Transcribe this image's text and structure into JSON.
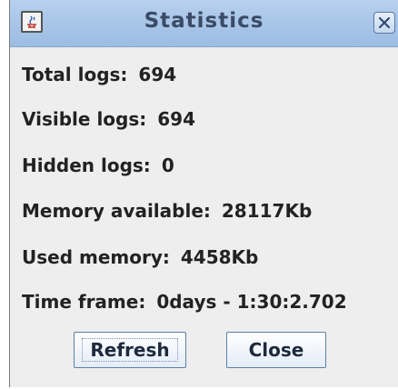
{
  "window": {
    "title": "Statistics",
    "icons": {
      "app": "java-cup-icon",
      "close": "close-icon"
    }
  },
  "stats": [
    {
      "label": "Total logs:",
      "value": "694"
    },
    {
      "label": "Visible logs:",
      "value": "694"
    },
    {
      "label": "Hidden logs:",
      "value": "0"
    },
    {
      "label": "Memory available:",
      "value": "28117Kb"
    },
    {
      "label": "Used memory:",
      "value": "4458Kb"
    },
    {
      "label": "Time frame:",
      "value": "0days - 1:30:2.702"
    }
  ],
  "buttons": {
    "refresh_label": "Refresh",
    "close_label": "Close"
  },
  "colors": {
    "titlebar": "#a9c6e8",
    "dialog_bg": "#eeeeee",
    "title_text": "#3a4b66"
  }
}
